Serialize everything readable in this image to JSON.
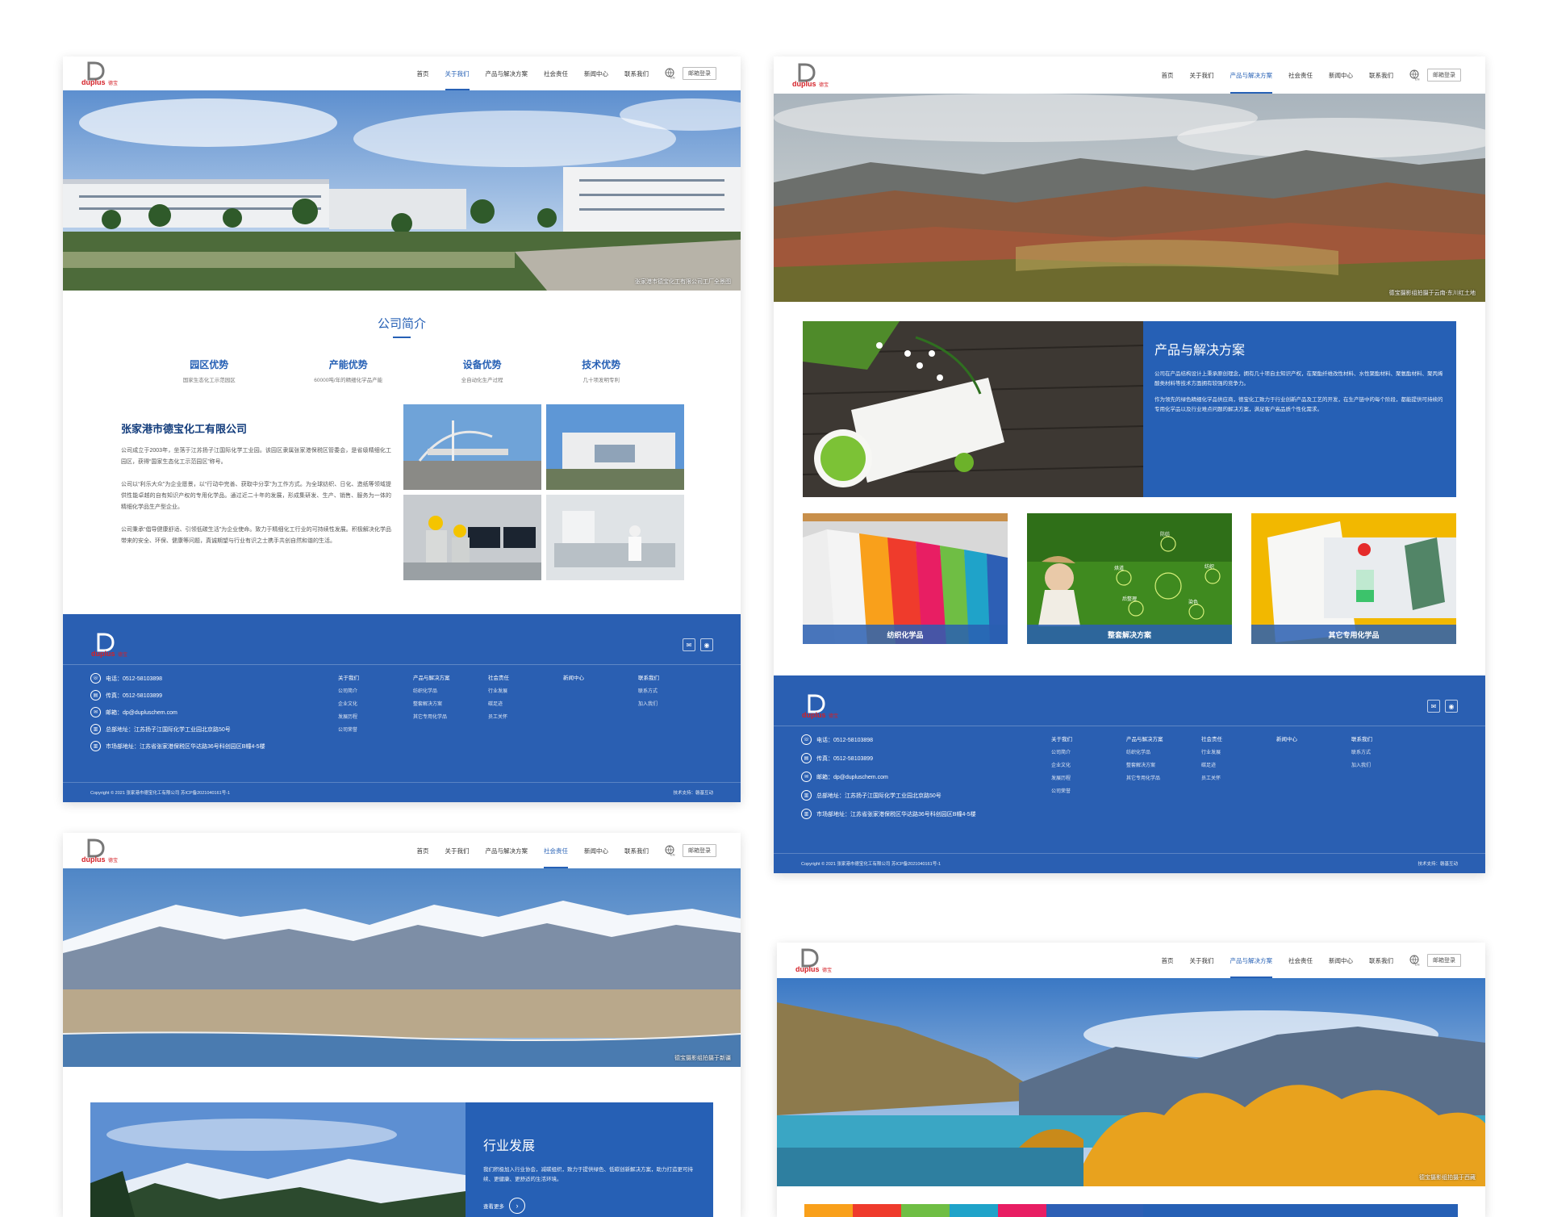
{
  "brand": {
    "logo_text": "duplus",
    "logo_cn": "德宝"
  },
  "nav": {
    "home": "首页",
    "about": "关于我们",
    "products": "产品与解决方案",
    "csr": "社会责任",
    "news": "新闻中心",
    "contact": "联系我们",
    "lang": "EN",
    "login": "邮箱登录"
  },
  "about_page": {
    "hero_caption": "张家港市德宝化工有限公司工厂全景图",
    "section_title": "公司简介",
    "advantages": [
      {
        "title": "园区优势",
        "desc": "国家生态化工示范园区"
      },
      {
        "title": "产能优势",
        "desc": "60000吨/年的精细化学品产能"
      },
      {
        "title": "设备优势",
        "desc": "全自动化生产过程"
      },
      {
        "title": "技术优势",
        "desc": "几十项发明专利"
      }
    ],
    "company_name": "张家港市德宝化工有限公司",
    "paragraphs": [
      "公司成立于2003年，坐落于江苏扬子江国际化学工业园。该园区隶属张家港保税区管委会，是省级精细化工园区，获得“国家生态化工示范园区”称号。",
      "公司以“利乐大众”为企业愿景，以“行动中完善、获取中分享”为工作方式。为全球纺织、日化、造纸等领域提供性能卓越的自有知识产权的专用化学品。通过近二十年的发展，形成集研发、生产、销售、服务为一体的精细化学品生产型企业。",
      "公司秉承“倡导健康舒适、引领低碳生活”为企业使命。致力于精细化工行业的可持续性发展。积极解决化学品带来的安全、环保、健康等问题，真诚期望与行业有识之士携手共创自然和谐的生活。"
    ]
  },
  "footer": {
    "phone": "电话：0512-58103898",
    "fax": "传真：0512-58103899",
    "email": "邮箱：dp@dupluschem.com",
    "hq": "总部地址：江苏扬子江国际化学工业园北京路50号",
    "market": "市场部地址：江苏省张家港保税区华达路36号科创园区B幢4-5楼",
    "col_about": {
      "h": "关于我们",
      "items": [
        "公司简介",
        "企业文化",
        "发展历程",
        "公司荣誉"
      ]
    },
    "col_products": {
      "h": "产品与解决方案",
      "items": [
        "纺织化学品",
        "整套解决方案",
        "其它专用化学品"
      ]
    },
    "col_csr": {
      "h": "社会责任",
      "items": [
        "行业发展",
        "碳足迹",
        "员工关怀"
      ]
    },
    "col_news": {
      "h": "新闻中心"
    },
    "col_contact": {
      "h": "联系我们",
      "items": [
        "联系方式",
        "加入我们"
      ]
    },
    "copyright": "Copyright © 2021 张家港市德宝化工有限公司 苏ICP备2021040161号-1",
    "tech": "技术支持：磐基互动"
  },
  "products_page": {
    "hero_caption": "德宝摄影组拍摄于云南-东川红土地",
    "title": "产品与解决方案",
    "paragraphs": [
      "公司在产品结构设计上秉承原创理念，拥有几十项自主知识产权，在聚酯纤维改性材料、水性聚酯材料、聚氨酯材料、聚丙烯酸类材料等技术方面拥有较强的竞争力。",
      "作为领先的绿色精细化学品供应商，德宝化工致力于行业创新产品及工艺的开发，在生产链中的每个阶段，都能提供可持续的专用化学品以及行业难点问题的解决方案，满足客户高品质个性化需求。"
    ],
    "cards": [
      "纺织化学品",
      "整套解决方案",
      "其它专用化学品"
    ],
    "card2_labels": [
      "防纺",
      "烘道",
      "纺织",
      "后整理",
      "染色"
    ]
  },
  "csr_page": {
    "hero_caption": "德宝摄影组拍摄于新疆",
    "title": "行业发展",
    "text": "我们积极加入行业协会，减碳组织，致力于提供绿色、低碳创新解决方案，助力打造更可持续、更健康、更舒适的生活环境。",
    "more": "查看更多"
  },
  "products_page2": {
    "hero_caption": "德宝摄影组拍摄于西藏"
  },
  "colors": {
    "primary": "#2660b5",
    "footer": "#2a5fb2",
    "logo_red": "#d42027"
  }
}
